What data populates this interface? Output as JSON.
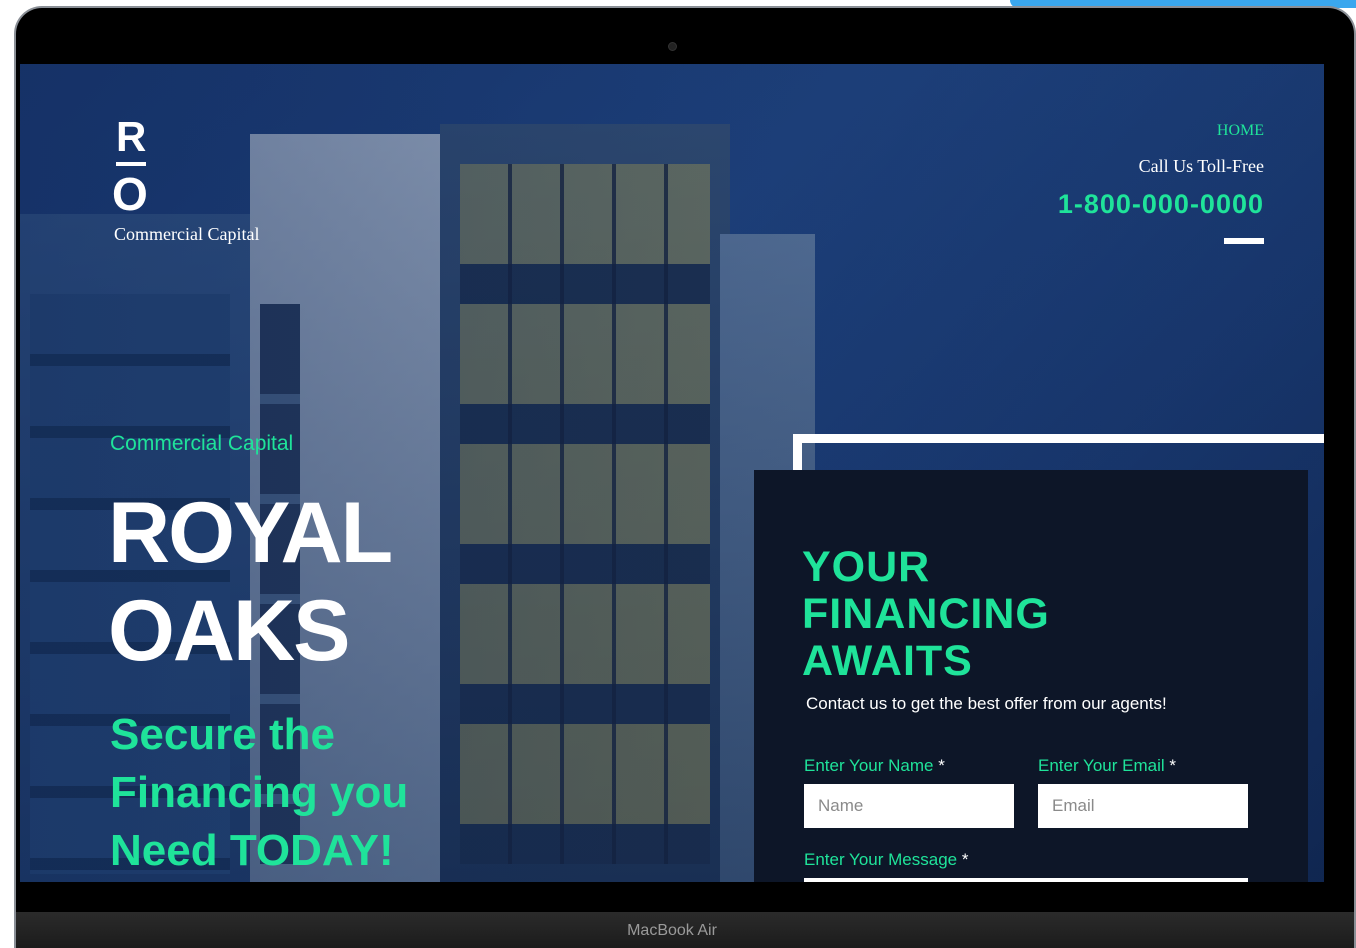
{
  "device": {
    "label": "MacBook Air"
  },
  "logo": {
    "letter_top": "R",
    "letter_bottom": "O",
    "name": "Commercial Capital"
  },
  "nav": {
    "home": "HOME",
    "call_label": "Call Us Toll-Free",
    "phone": "1-800-000-0000",
    "menu_icon": "menu-bar-icon"
  },
  "hero": {
    "kicker": "Commercial Capital",
    "title_line1": "ROYAL",
    "title_line2": "OAKS",
    "subtitle_line1": "Secure the",
    "subtitle_line2": "Financing you",
    "subtitle_line3": "Need TODAY!"
  },
  "form": {
    "title_line1": "YOUR",
    "title_line2": "FINANCING",
    "title_line3": "AWAITS",
    "description": "Contact us to get the best offer from our agents!",
    "name_label": "Enter Your Name",
    "name_placeholder": "Name",
    "email_label": "Enter Your Email",
    "email_placeholder": "Email",
    "message_label": "Enter Your Message",
    "required_mark": "*"
  },
  "colors": {
    "accent": "#1fe39a",
    "card": "#0d1628",
    "text": "#ffffff"
  }
}
